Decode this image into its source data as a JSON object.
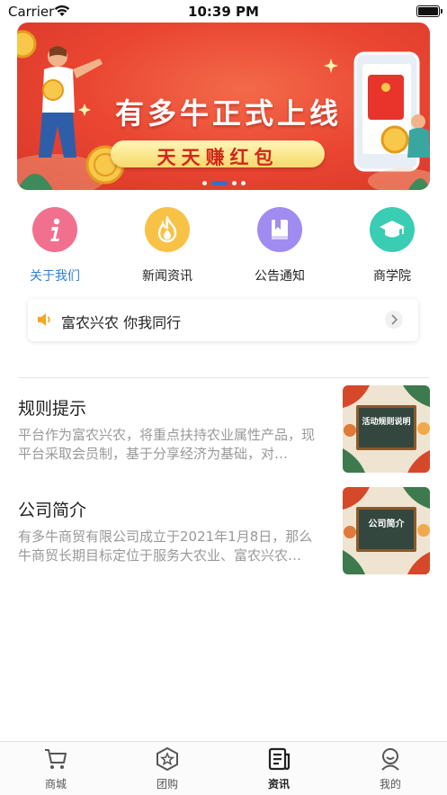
{
  "status_bar": {
    "carrier": "Carrier",
    "time": "10:39 PM"
  },
  "banner": {
    "title": "有多牛正式上线",
    "subtitle": "天天赚红包",
    "page_count": 4,
    "active_index": 1
  },
  "quick_menu": [
    {
      "label": "关于我们",
      "icon": "info-icon",
      "color": "#f2708f",
      "active": true
    },
    {
      "label": "新闻资讯",
      "icon": "flame-icon",
      "color": "#f8c247",
      "active": false
    },
    {
      "label": "公告通知",
      "icon": "bookmark-icon",
      "color": "#a08cf0",
      "active": false
    },
    {
      "label": "商学院",
      "icon": "graduation-cap-icon",
      "color": "#39cdb4",
      "active": false
    }
  ],
  "notice": {
    "text": "富农兴农 你我同行",
    "icon": "speaker-icon"
  },
  "articles": [
    {
      "title": "规则提示",
      "desc": "平台作为富农兴农，将重点扶持农业属性产品，现平台采取会员制，基于分享经济为基础，对…",
      "thumb_text": "活动规则说明"
    },
    {
      "title": "公司简介",
      "desc": "有多牛商贸有限公司成立于2021年1月8日，那么牛商贸长期目标定位于服务大农业、富农兴农…",
      "thumb_text": "公司简介"
    }
  ],
  "tabbar": [
    {
      "label": "商城",
      "icon": "cart-icon",
      "active": false
    },
    {
      "label": "团购",
      "icon": "star-badge-icon",
      "active": false
    },
    {
      "label": "资讯",
      "icon": "news-icon",
      "active": true
    },
    {
      "label": "我的",
      "icon": "profile-icon",
      "active": false
    }
  ],
  "colors": {
    "accent": "#2e7fd6",
    "banner_red": "#ea4632",
    "desc_gray": "#999999"
  }
}
